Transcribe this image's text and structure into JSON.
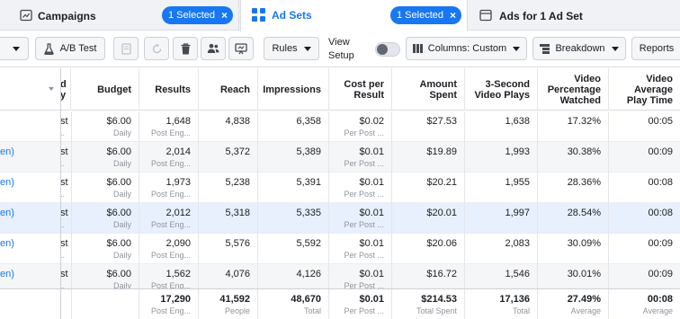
{
  "tabs": {
    "campaigns": {
      "label": "Campaigns",
      "pill": "1 Selected",
      "icon": "folder-icon"
    },
    "adsets": {
      "label": "Ad Sets",
      "pill": "1 Selected",
      "icon": "grid-icon"
    },
    "ads": {
      "label": "Ads for 1 Ad Set",
      "icon": "ad-icon"
    }
  },
  "toolbar": {
    "ab_test": "A/B Test",
    "view_setup": "View Setup",
    "view_setup_on": false,
    "rules": "Rules",
    "columns": "Columns: Custom",
    "breakdown": "Breakdown",
    "reports": "Reports"
  },
  "colors": {
    "accent": "#1877f2",
    "tab_bg": "#f0f2f5",
    "border": "#dadde1",
    "alt_row": "#f5f6f7",
    "selected_row": "#e7f0fc",
    "muted_text": "#90949c"
  },
  "table": {
    "headers": {
      "partial_1": "d",
      "partial_2": "y",
      "budget": "Budget",
      "results": "Results",
      "reach": "Reach",
      "impressions": "Impressions",
      "cpr_1": "Cost per",
      "cpr_2": "Result",
      "spent_1": "Amount",
      "spent_2": "Spent",
      "plays_1": "3-Second",
      "plays_2": "Video Plays",
      "pct_1": "Video",
      "pct_2": "Percentage",
      "pct_3": "Watched",
      "avg_1": "Video",
      "avg_2": "Average",
      "avg_3": "Play Time"
    },
    "rows": [
      {
        "name": "",
        "partial": "st",
        "partial_sub": "..",
        "budget": "$6.00",
        "budget_sub": "Daily",
        "results": "1,648",
        "results_sub": "Post Eng...",
        "reach": "4,838",
        "impressions": "6,358",
        "cpr": "$0.02",
        "cpr_sub": "Per Post ...",
        "spent": "$27.53",
        "plays": "1,638",
        "pct": "17.32%",
        "avg": "00:05"
      },
      {
        "name": "en)",
        "partial": "st",
        "partial_sub": "..",
        "budget": "$6.00",
        "budget_sub": "Daily",
        "results": "2,014",
        "results_sub": "Post Eng...",
        "reach": "5,372",
        "impressions": "5,389",
        "cpr": "$0.01",
        "cpr_sub": "Per Post ...",
        "spent": "$19.89",
        "plays": "1,993",
        "pct": "30.38%",
        "avg": "00:09"
      },
      {
        "name": "en)",
        "partial": "st",
        "partial_sub": "..",
        "budget": "$6.00",
        "budget_sub": "Daily",
        "results": "1,973",
        "results_sub": "Post Eng...",
        "reach": "5,238",
        "impressions": "5,391",
        "cpr": "$0.01",
        "cpr_sub": "Per Post ...",
        "spent": "$20.21",
        "plays": "1,955",
        "pct": "28.36%",
        "avg": "00:08"
      },
      {
        "name": "en)",
        "partial": "st",
        "partial_sub": "..",
        "budget": "$6.00",
        "budget_sub": "Daily",
        "results": "2,012",
        "results_sub": "Post Eng...",
        "reach": "5,318",
        "impressions": "5,335",
        "cpr": "$0.01",
        "cpr_sub": "Per Post ...",
        "spent": "$20.01",
        "plays": "1,997",
        "pct": "28.54%",
        "avg": "00:08"
      },
      {
        "name": "en)",
        "partial": "st",
        "partial_sub": "..",
        "budget": "$6.00",
        "budget_sub": "Daily",
        "results": "2,090",
        "results_sub": "Post Eng...",
        "reach": "5,576",
        "impressions": "5,592",
        "cpr": "$0.01",
        "cpr_sub": "Per Post ...",
        "spent": "$20.06",
        "plays": "2,083",
        "pct": "30.09%",
        "avg": "00:09"
      },
      {
        "name": "en)",
        "partial": "st",
        "partial_sub": "..",
        "budget": "$6.00",
        "budget_sub": "Daily",
        "results": "1,562",
        "results_sub": "Post Eng...",
        "reach": "4,076",
        "impressions": "4,126",
        "cpr": "$0.01",
        "cpr_sub": "Per Post ...",
        "spent": "$16.72",
        "plays": "1,546",
        "pct": "30.01%",
        "avg": "00:09"
      }
    ],
    "total": {
      "results": "17,290",
      "results_sub": "Post Eng...",
      "reach": "41,592",
      "reach_sub": "People",
      "impressions": "48,670",
      "impressions_sub": "Total",
      "cpr": "$0.01",
      "cpr_sub": "Per Post ...",
      "spent": "$214.53",
      "spent_sub": "Total Spent",
      "plays": "17,136",
      "plays_sub": "Total",
      "pct": "27.49%",
      "pct_sub": "Average",
      "avg": "00:08",
      "avg_sub": "Average"
    }
  }
}
